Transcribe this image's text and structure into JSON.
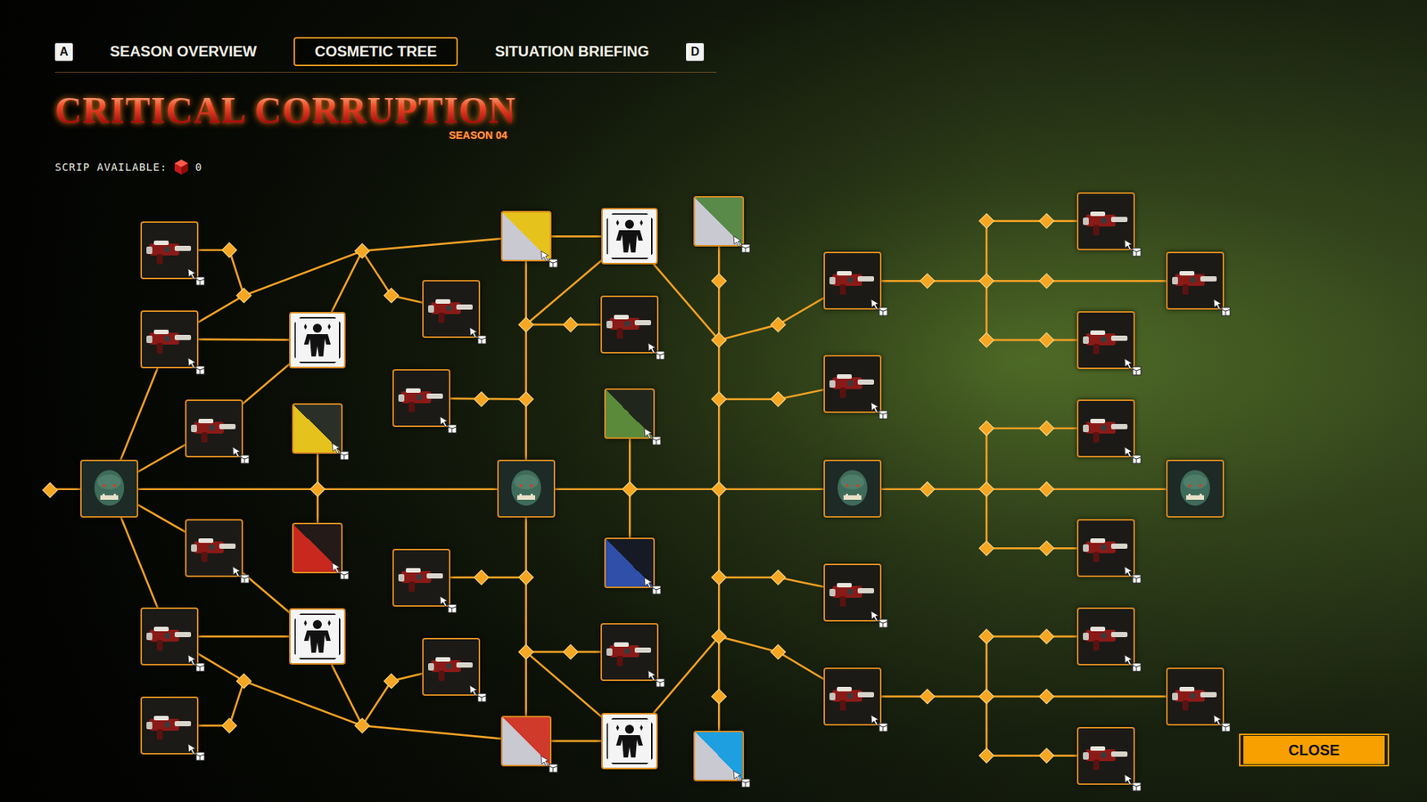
{
  "tabs": {
    "prev_key": "A",
    "next_key": "D",
    "items": [
      {
        "label": "SEASON OVERVIEW",
        "selected": false
      },
      {
        "label": "COSMETIC TREE",
        "selected": true
      },
      {
        "label": "SITUATION BRIEFING",
        "selected": false
      }
    ]
  },
  "logo": {
    "title": "CRITICAL CORRUPTION",
    "subtitle": "SEASON 04"
  },
  "scrip": {
    "label": "SCRIP AVAILABLE:",
    "value": "0"
  },
  "tree": {
    "nodes": [
      {
        "kind": "head"
      },
      {
        "kind": "weapon"
      },
      {
        "kind": "weapon"
      },
      {
        "kind": "weapon"
      },
      {
        "kind": "weapon"
      },
      {
        "kind": "weapon"
      },
      {
        "kind": "weapon"
      },
      {
        "kind": "emblem"
      },
      {
        "kind": "emblem"
      },
      {
        "kind": "swatch",
        "colors": [
          "#e6c21c",
          "#2a3028"
        ]
      },
      {
        "kind": "swatch",
        "colors": [
          "#c8281e",
          "#241a18"
        ]
      },
      {
        "kind": "weapon"
      },
      {
        "kind": "weapon"
      },
      {
        "kind": "weapon"
      },
      {
        "kind": "weapon"
      },
      {
        "kind": "swatch",
        "colors": [
          "#c9c9d2",
          "#e6c21c"
        ]
      },
      {
        "kind": "head"
      },
      {
        "kind": "swatch",
        "colors": [
          "#c9c9d2",
          "#d03a2a"
        ]
      },
      {
        "kind": "emblem"
      },
      {
        "kind": "weapon"
      },
      {
        "kind": "swatch",
        "colors": [
          "#5a8a3a",
          "#20261c"
        ]
      },
      {
        "kind": "swatch",
        "colors": [
          "#2f4fa8",
          "#161a24"
        ]
      },
      {
        "kind": "weapon"
      },
      {
        "kind": "emblem"
      },
      {
        "kind": "swatch",
        "colors": [
          "#c9c9d2",
          "#5a8a4a"
        ]
      },
      {
        "kind": "swatch",
        "colors": [
          "#c9c9d2",
          "#1ea0e0"
        ]
      },
      {
        "kind": "weapon"
      },
      {
        "kind": "weapon"
      },
      {
        "kind": "head"
      },
      {
        "kind": "weapon"
      },
      {
        "kind": "weapon"
      },
      {
        "kind": "weapon"
      },
      {
        "kind": "weapon"
      },
      {
        "kind": "weapon"
      },
      {
        "kind": "weapon"
      },
      {
        "kind": "head"
      },
      {
        "kind": "weapon"
      },
      {
        "kind": "weapon"
      },
      {
        "kind": "weapon"
      },
      {
        "kind": "weapon"
      }
    ]
  },
  "buttons": [
    "CLOSE"
  ]
}
